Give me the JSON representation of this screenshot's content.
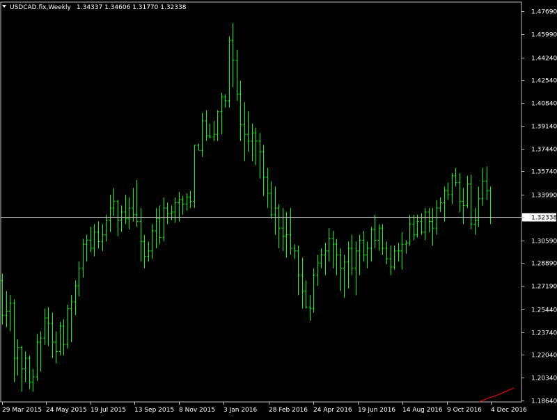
{
  "header": {
    "symbol_timeframe": "USDCAD.fix,Weekly",
    "ohlc": "1.34337 1.34606 1.31770 1.32338"
  },
  "colors": {
    "background": "#000000",
    "bars": "#00ff00",
    "frame": "#c0c0c0",
    "text": "#ffffff",
    "price_line": "#c0c0c0",
    "price_label_bg": "#ffffff",
    "price_label_text": "#000000",
    "indicator": "#ff0000"
  },
  "chart_data": {
    "type": "ohlc",
    "title": "USDCAD.fix,Weekly",
    "ylim": [
      1.1864,
      1.4769
    ],
    "y_ticks": [
      "1.47690",
      "1.45990",
      "1.44240",
      "1.42540",
      "1.40840",
      "1.39140",
      "1.37440",
      "1.35740",
      "1.33990",
      "1.32338",
      "1.30590",
      "1.28890",
      "1.27190",
      "1.25440",
      "1.23740",
      "1.22040",
      "1.20340",
      "1.18640"
    ],
    "x_labels": [
      "29 Mar 2015",
      "24 May 2015",
      "19 Jul 2015",
      "13 Sep 2015",
      "8 Nov 2015",
      "3 Jan 2016",
      "28 Feb 2016",
      "24 Apr 2016",
      "19 Jun 2016",
      "14 Aug 2016",
      "9 Oct 2016",
      "4 Dec 2016"
    ],
    "current_price": "1.32338",
    "bars": [
      [
        1.276,
        1.281,
        1.243,
        1.25
      ],
      [
        1.25,
        1.268,
        1.241,
        1.253
      ],
      [
        1.253,
        1.265,
        1.238,
        1.259
      ],
      [
        1.259,
        1.262,
        1.2,
        1.218
      ],
      [
        1.218,
        1.232,
        1.205,
        1.226
      ],
      [
        1.226,
        1.227,
        1.193,
        1.21
      ],
      [
        1.21,
        1.223,
        1.2,
        1.218
      ],
      [
        1.218,
        1.22,
        1.195,
        1.2
      ],
      [
        1.2,
        1.21,
        1.193,
        1.204
      ],
      [
        1.204,
        1.236,
        1.201,
        1.23
      ],
      [
        1.23,
        1.238,
        1.208,
        1.233
      ],
      [
        1.233,
        1.255,
        1.228,
        1.248
      ],
      [
        1.248,
        1.256,
        1.227,
        1.244
      ],
      [
        1.244,
        1.252,
        1.218,
        1.23
      ],
      [
        1.23,
        1.238,
        1.214,
        1.223
      ],
      [
        1.223,
        1.245,
        1.22,
        1.242
      ],
      [
        1.242,
        1.247,
        1.22,
        1.228
      ],
      [
        1.228,
        1.258,
        1.225,
        1.255
      ],
      [
        1.255,
        1.265,
        1.23,
        1.26
      ],
      [
        1.26,
        1.276,
        1.25,
        1.272
      ],
      [
        1.272,
        1.29,
        1.264,
        1.285
      ],
      [
        1.285,
        1.307,
        1.278,
        1.303
      ],
      [
        1.303,
        1.31,
        1.29,
        1.306
      ],
      [
        1.306,
        1.316,
        1.297,
        1.3
      ],
      [
        1.3,
        1.318,
        1.294,
        1.312
      ],
      [
        1.312,
        1.32,
        1.3,
        1.305
      ],
      [
        1.305,
        1.318,
        1.298,
        1.31
      ],
      [
        1.31,
        1.325,
        1.305,
        1.321
      ],
      [
        1.321,
        1.34,
        1.312,
        1.33
      ],
      [
        1.33,
        1.345,
        1.324,
        1.335
      ],
      [
        1.335,
        1.336,
        1.309,
        1.321
      ],
      [
        1.321,
        1.332,
        1.312,
        1.327
      ],
      [
        1.327,
        1.34,
        1.318,
        1.322
      ],
      [
        1.322,
        1.338,
        1.314,
        1.33
      ],
      [
        1.33,
        1.345,
        1.32,
        1.325
      ],
      [
        1.325,
        1.351,
        1.316,
        1.32
      ],
      [
        1.32,
        1.33,
        1.29,
        1.305
      ],
      [
        1.305,
        1.31,
        1.285,
        1.294
      ],
      [
        1.294,
        1.305,
        1.29,
        1.298
      ],
      [
        1.298,
        1.318,
        1.292,
        1.313
      ],
      [
        1.313,
        1.33,
        1.3,
        1.322
      ],
      [
        1.322,
        1.332,
        1.303,
        1.308
      ],
      [
        1.308,
        1.338,
        1.305,
        1.33
      ],
      [
        1.33,
        1.334,
        1.318,
        1.326
      ],
      [
        1.326,
        1.332,
        1.321,
        1.327
      ],
      [
        1.327,
        1.338,
        1.319,
        1.334
      ],
      [
        1.334,
        1.342,
        1.32,
        1.336
      ],
      [
        1.336,
        1.339,
        1.325,
        1.333
      ],
      [
        1.333,
        1.341,
        1.328,
        1.338
      ],
      [
        1.338,
        1.343,
        1.33,
        1.335
      ],
      [
        1.335,
        1.377,
        1.33,
        1.377
      ],
      [
        1.377,
        1.378,
        1.373,
        1.373
      ],
      [
        1.373,
        1.401,
        1.368,
        1.395
      ],
      [
        1.395,
        1.403,
        1.38,
        1.384
      ],
      [
        1.384,
        1.393,
        1.382,
        1.383
      ],
      [
        1.383,
        1.395,
        1.38,
        1.385
      ],
      [
        1.385,
        1.403,
        1.38,
        1.402
      ],
      [
        1.402,
        1.416,
        1.385,
        1.413
      ],
      [
        1.413,
        1.415,
        1.405,
        1.41
      ],
      [
        1.41,
        1.458,
        1.405,
        1.455
      ],
      [
        1.455,
        1.468,
        1.42,
        1.44
      ],
      [
        1.44,
        1.448,
        1.41,
        1.415
      ],
      [
        1.415,
        1.425,
        1.38,
        1.392
      ],
      [
        1.392,
        1.409,
        1.365,
        1.385
      ],
      [
        1.385,
        1.402,
        1.372,
        1.38
      ],
      [
        1.38,
        1.393,
        1.365,
        1.386
      ],
      [
        1.386,
        1.39,
        1.362,
        1.38
      ],
      [
        1.38,
        1.386,
        1.352,
        1.372
      ],
      [
        1.372,
        1.377,
        1.339,
        1.353
      ],
      [
        1.353,
        1.36,
        1.33,
        1.341
      ],
      [
        1.341,
        1.35,
        1.322,
        1.325
      ],
      [
        1.325,
        1.346,
        1.31,
        1.33
      ],
      [
        1.33,
        1.333,
        1.3,
        1.315
      ],
      [
        1.315,
        1.33,
        1.298,
        1.309
      ],
      [
        1.309,
        1.327,
        1.293,
        1.31
      ],
      [
        1.31,
        1.33,
        1.295,
        1.3
      ],
      [
        1.3,
        1.303,
        1.292,
        1.298
      ],
      [
        1.298,
        1.302,
        1.265,
        1.28
      ],
      [
        1.28,
        1.293,
        1.255,
        1.268
      ],
      [
        1.268,
        1.276,
        1.255,
        1.256
      ],
      [
        1.256,
        1.265,
        1.246,
        1.255
      ],
      [
        1.255,
        1.285,
        1.252,
        1.28
      ],
      [
        1.28,
        1.295,
        1.272,
        1.289
      ],
      [
        1.289,
        1.3,
        1.285,
        1.295
      ],
      [
        1.295,
        1.304,
        1.28,
        1.298
      ],
      [
        1.298,
        1.315,
        1.29,
        1.307
      ],
      [
        1.307,
        1.313,
        1.285,
        1.303
      ],
      [
        1.303,
        1.307,
        1.28,
        1.295
      ],
      [
        1.295,
        1.3,
        1.268,
        1.285
      ],
      [
        1.285,
        1.295,
        1.263,
        1.29
      ],
      [
        1.29,
        1.305,
        1.27,
        1.3
      ],
      [
        1.3,
        1.31,
        1.28,
        1.285
      ],
      [
        1.285,
        1.305,
        1.265,
        1.298
      ],
      [
        1.298,
        1.31,
        1.28,
        1.306
      ],
      [
        1.306,
        1.313,
        1.29,
        1.295
      ],
      [
        1.295,
        1.305,
        1.285,
        1.3
      ],
      [
        1.3,
        1.316,
        1.29,
        1.314
      ],
      [
        1.314,
        1.325,
        1.3,
        1.306
      ],
      [
        1.306,
        1.318,
        1.298,
        1.315
      ],
      [
        1.315,
        1.318,
        1.295,
        1.3
      ],
      [
        1.3,
        1.305,
        1.288,
        1.292
      ],
      [
        1.292,
        1.302,
        1.28,
        1.286
      ],
      [
        1.286,
        1.302,
        1.284,
        1.298
      ],
      [
        1.298,
        1.304,
        1.29,
        1.298
      ],
      [
        1.298,
        1.312,
        1.284,
        1.303
      ],
      [
        1.303,
        1.306,
        1.296,
        1.304
      ],
      [
        1.304,
        1.325,
        1.302,
        1.318
      ],
      [
        1.318,
        1.325,
        1.306,
        1.31
      ],
      [
        1.31,
        1.325,
        1.308,
        1.32
      ],
      [
        1.32,
        1.326,
        1.31,
        1.312
      ],
      [
        1.312,
        1.33,
        1.306,
        1.327
      ],
      [
        1.327,
        1.33,
        1.312,
        1.32
      ],
      [
        1.32,
        1.33,
        1.302,
        1.315
      ],
      [
        1.315,
        1.336,
        1.31,
        1.33
      ],
      [
        1.33,
        1.338,
        1.327,
        1.334
      ],
      [
        1.334,
        1.346,
        1.32,
        1.343
      ],
      [
        1.343,
        1.349,
        1.336,
        1.34
      ],
      [
        1.34,
        1.356,
        1.333,
        1.354
      ],
      [
        1.354,
        1.36,
        1.346,
        1.349
      ],
      [
        1.349,
        1.356,
        1.327,
        1.335
      ],
      [
        1.335,
        1.345,
        1.318,
        1.332
      ],
      [
        1.332,
        1.354,
        1.33,
        1.348
      ],
      [
        1.348,
        1.355,
        1.314,
        1.318
      ],
      [
        1.318,
        1.33,
        1.31,
        1.321
      ],
      [
        1.321,
        1.346,
        1.316,
        1.337
      ],
      [
        1.337,
        1.36,
        1.332,
        1.35
      ],
      [
        1.35,
        1.361,
        1.336,
        1.343
      ],
      [
        1.343,
        1.346,
        1.318,
        1.323
      ]
    ]
  }
}
